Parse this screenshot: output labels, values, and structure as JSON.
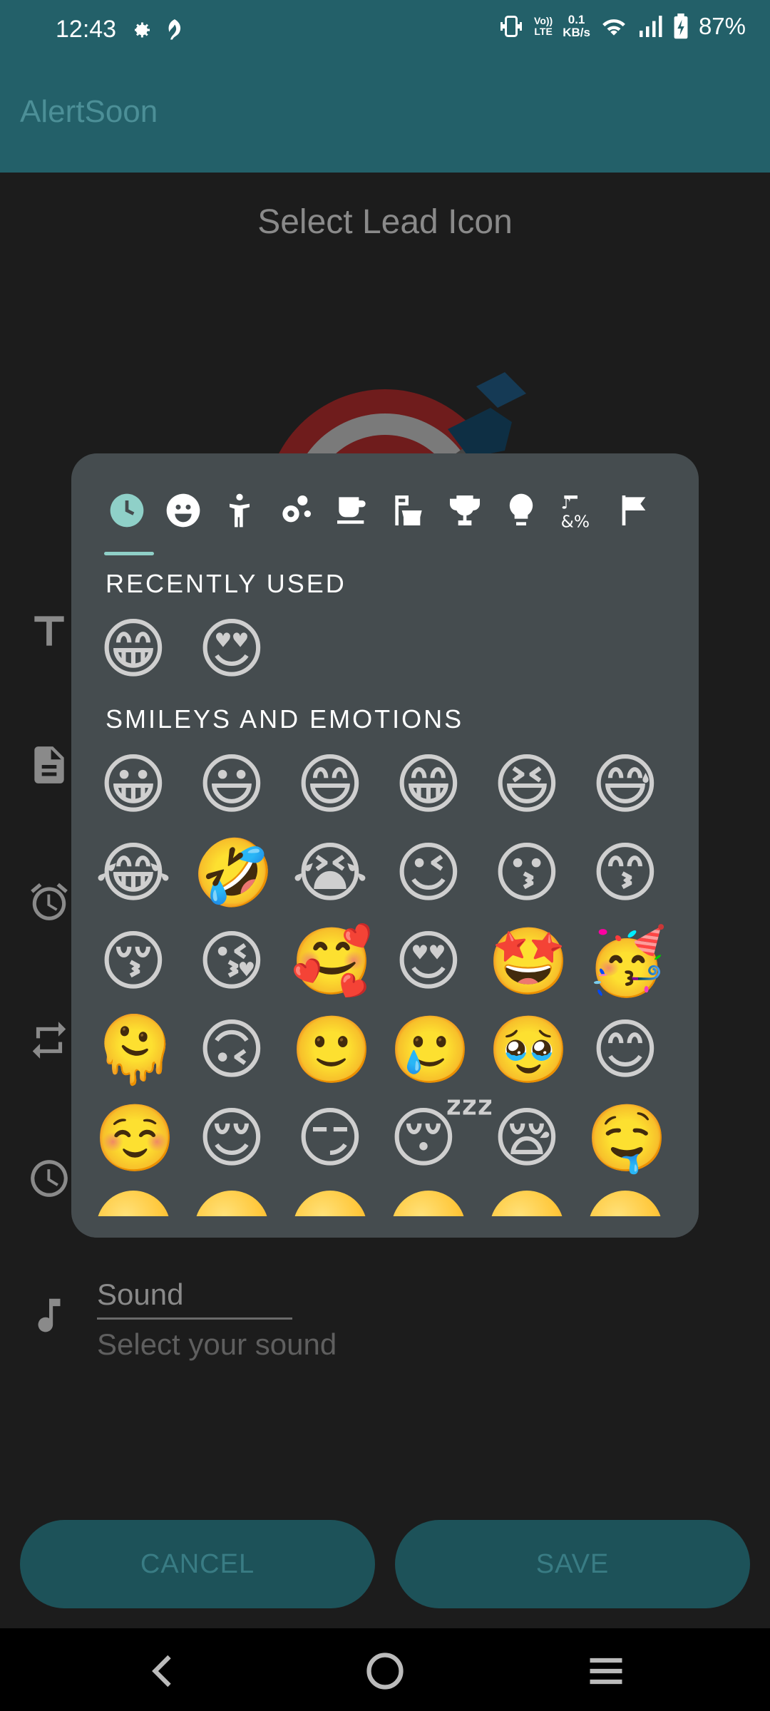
{
  "status_bar": {
    "time": "12:43",
    "volte_line1": "Vo))",
    "volte_line2": "LTE",
    "net_speed_value": "0.1",
    "net_speed_unit": "KB/s",
    "battery": "87%"
  },
  "app_bar": {
    "title": "AlertSoon"
  },
  "content": {
    "lead_title": "Select Lead Icon",
    "sound_label": "Sound",
    "sound_hint": "Select your sound"
  },
  "picker": {
    "tabs": [
      "recent-icon",
      "smiley-icon",
      "person-icon",
      "nature-icon",
      "food-icon",
      "travel-icon",
      "activity-icon",
      "objects-icon",
      "symbols-icon",
      "flag-icon"
    ],
    "recent_title": "RECENTLY USED",
    "recent": [
      "😁",
      "😍"
    ],
    "smileys_title": "SMILEYS AND EMOTIONS",
    "smileys": [
      [
        "😀",
        "😃",
        "😄",
        "😁",
        "😆",
        "😅"
      ],
      [
        "😂",
        "🤣",
        "😭",
        "😉",
        "😗",
        "😙"
      ],
      [
        "😚",
        "😘",
        "🥰",
        "😍",
        "🤩",
        "🥳"
      ],
      [
        "🫠",
        "🙃",
        "🙂",
        "🥲",
        "🥹",
        "😊"
      ],
      [
        "☺️",
        "😌",
        "😏",
        "😴",
        "😪",
        "🤤"
      ]
    ]
  },
  "buttons": {
    "cancel": "CANCEL",
    "save": "SAVE"
  },
  "colors": {
    "accent": "#236069",
    "button_bg": "#1d5259",
    "picker_bg": "#454c4f",
    "tab_indicator": "#8fd0c8"
  }
}
